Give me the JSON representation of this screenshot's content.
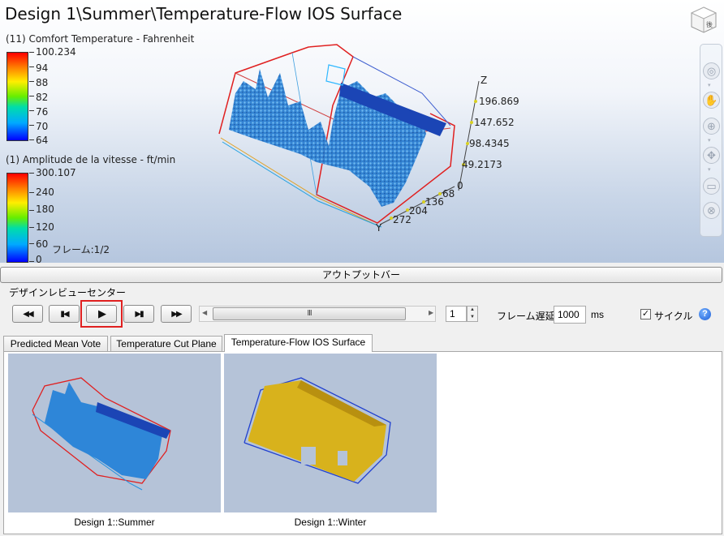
{
  "viewport": {
    "title": "Design 1\\Summer\\Temperature-Flow IOS Surface",
    "legend1": {
      "title": "(11) Comfort Temperature - Fahrenheit",
      "labels": [
        "100.234",
        "94",
        "88",
        "82",
        "76",
        "70",
        "64"
      ]
    },
    "legend2": {
      "title": "(1) Amplitude de la vitesse - ft/min",
      "labels": [
        "300.107",
        "240",
        "180",
        "120",
        "60",
        "0"
      ]
    },
    "frame_label": "フレーム:1/2",
    "axes": {
      "z_name": "Z",
      "z_values": [
        "196.869",
        "147.652",
        "98.4345",
        "49.2173",
        "0"
      ],
      "y_name": "Y",
      "y_values": [
        "68",
        "136",
        "204",
        "272"
      ]
    },
    "nav_icons": [
      "viewcube-icon",
      "orbit-icon",
      "pan-hand-icon",
      "zoom-icon",
      "walk-icon",
      "floor-icon",
      "close-icon"
    ]
  },
  "output_bar": {
    "label": "アウトプットバー"
  },
  "review_center": {
    "label": "デザインレビューセンター"
  },
  "playback": {
    "first_icon": "rewind-icon",
    "prev_icon": "step-back-icon",
    "play_icon": "play-icon",
    "next_icon": "step-forward-icon",
    "last_icon": "fast-forward-icon",
    "scroll_grip": "III",
    "frame_value": "1",
    "delay_label": "フレーム遅延:",
    "delay_value": "1000",
    "delay_unit": "ms",
    "cycle_checked": true,
    "cycle_label": "サイクル",
    "help": "?"
  },
  "tabs": [
    {
      "label": "Predicted Mean Vote",
      "active": false
    },
    {
      "label": "Temperature Cut Plane",
      "active": false
    },
    {
      "label": "Temperature-Flow IOS Surface",
      "active": true
    }
  ],
  "thumbnails": [
    {
      "caption": "Design 1::Summer",
      "color": "#2e86d8"
    },
    {
      "caption": "Design 1::Winter",
      "color": "#d8b21c"
    }
  ]
}
